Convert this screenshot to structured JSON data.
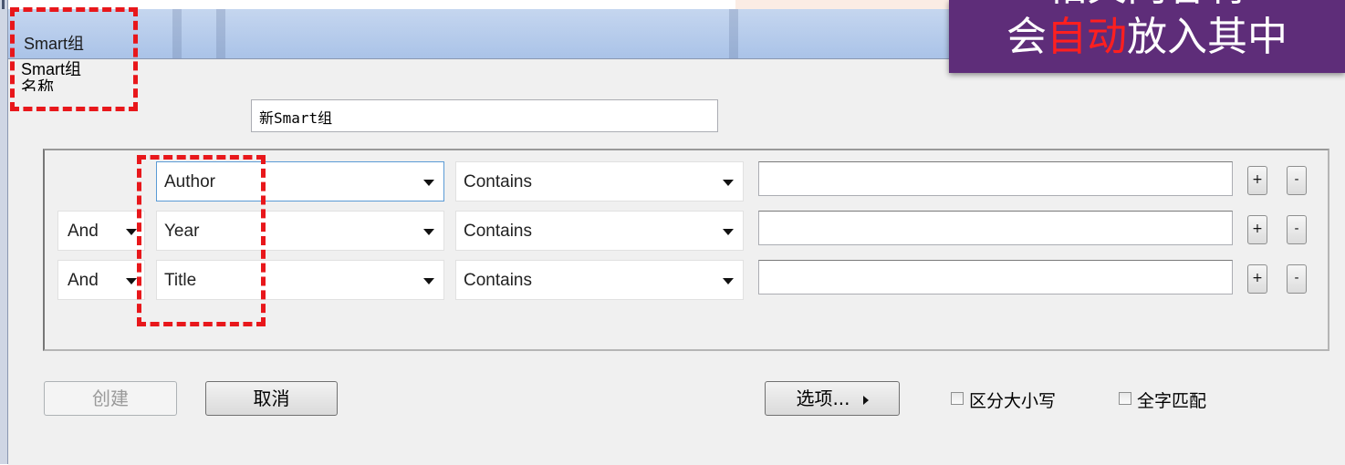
{
  "window": {
    "title": "Smart组"
  },
  "form": {
    "name_label": "Smart组\n名称",
    "name_value": "新Smart组"
  },
  "criteria": {
    "rows": [
      {
        "operator": "",
        "field": "Author",
        "condition": "Contains",
        "value": ""
      },
      {
        "operator": "And",
        "field": "Year",
        "condition": "Contains",
        "value": ""
      },
      {
        "operator": "And",
        "field": "Title",
        "condition": "Contains",
        "value": ""
      }
    ],
    "add_label": "+",
    "remove_label": "-"
  },
  "buttons": {
    "create": "创建",
    "cancel": "取消",
    "options": "选项..."
  },
  "options": {
    "match_case": {
      "label": "区分大小写",
      "checked": false
    },
    "whole_word": {
      "label": "全字匹配",
      "checked": false
    }
  },
  "callout": {
    "line1": "相关内容将",
    "line2_pre": "会",
    "line2_highlight": "自动",
    "line2_post": "放入其中"
  },
  "colors": {
    "callout_bg": "#5e2d79",
    "highlight_red": "#ff1f1f",
    "annotation_dash": "#e8171b",
    "titlebar": "#b6cbed"
  }
}
